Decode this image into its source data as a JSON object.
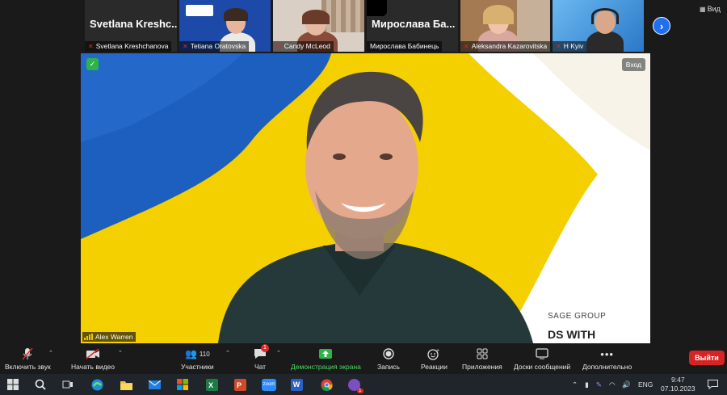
{
  "participants": [
    {
      "name": "Svetlana Kreshchanova",
      "display": "Svetlana  Kreshc...",
      "muted": true,
      "video": false
    },
    {
      "name": "Tetiana Oratovska",
      "muted": true,
      "video": true
    },
    {
      "name": "Candy McLeod",
      "muted": true,
      "video": true
    },
    {
      "name": "Мирослава Бабинець",
      "display": "Мирослава  Ба...",
      "muted": false,
      "video": false
    },
    {
      "name": "Aleksandra Kazarovitska",
      "muted": true,
      "video": true
    },
    {
      "name": "H Kyiv",
      "muted": true,
      "video": true
    }
  ],
  "view_button": "Вид",
  "main_video": {
    "speaker_name": "Alex Warren",
    "enter_label": "Вход",
    "brand_line1": "SAGE GROUP",
    "brand_line2": "DS WITH"
  },
  "toolbar": {
    "unmute": "Включить звук",
    "start_video": "Начать видео",
    "participants": "Участники",
    "participants_count": "110",
    "chat": "Чат",
    "chat_badge": "1",
    "share": "Демонстрация экрана",
    "record": "Запись",
    "reactions": "Реакции",
    "apps": "Приложения",
    "whiteboards": "Доски сообщений",
    "more": "Дополнительно",
    "leave": "Выйти"
  },
  "taskbar": {
    "lang": "ENG",
    "time": "9:47",
    "date": "07.10.2023",
    "teams_badge": "1",
    "word_letter": "W",
    "zoom_text": "zoom"
  },
  "colors": {
    "accent_green": "#2db34a",
    "leave_red": "#d42424",
    "ukraine_blue": "#1d5fbf",
    "ukraine_yellow": "#f5d000"
  }
}
